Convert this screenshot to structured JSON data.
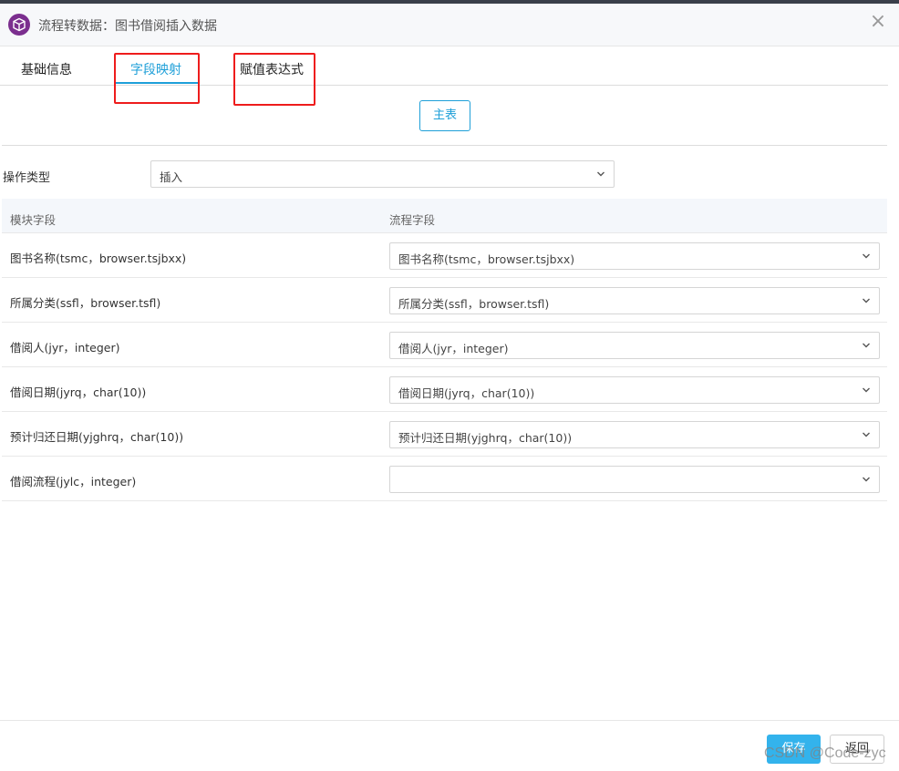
{
  "window": {
    "title": "流程转数据：图书借阅插入数据",
    "close_symbol": "×",
    "icon": "box-icon",
    "accent_color": "#7b2e8e"
  },
  "tabs": [
    {
      "label": "基础信息",
      "active": false
    },
    {
      "label": "字段映射",
      "active": true
    },
    {
      "label": "赋值表达式",
      "active": false
    }
  ],
  "main_table_button": "主表",
  "operation": {
    "label": "操作类型",
    "value": "插入"
  },
  "mapping_table": {
    "headers": [
      "模块字段",
      "流程字段"
    ],
    "rows": [
      {
        "module_field": "图书名称(tsmc，browser.tsjbxx)",
        "flow_field": "图书名称(tsmc，browser.tsjbxx)"
      },
      {
        "module_field": "所属分类(ssfl，browser.tsfl)",
        "flow_field": "所属分类(ssfl，browser.tsfl)"
      },
      {
        "module_field": "借阅人(jyr，integer)",
        "flow_field": "借阅人(jyr，integer)"
      },
      {
        "module_field": "借阅日期(jyrq，char(10))",
        "flow_field": "借阅日期(jyrq，char(10))"
      },
      {
        "module_field": "预计归还日期(yjghrq，char(10))",
        "flow_field": "预计归还日期(yjghrq，char(10))"
      },
      {
        "module_field": "借阅流程(jylc，integer)",
        "flow_field": ""
      }
    ]
  },
  "footer": {
    "save_label": "保存",
    "back_label": "返回"
  },
  "watermark": "CSDN @Code-zyc",
  "colors": {
    "primary": "#1e9fd8",
    "save_button": "#33b3ec",
    "annotation_box": "#ee1c1c"
  }
}
